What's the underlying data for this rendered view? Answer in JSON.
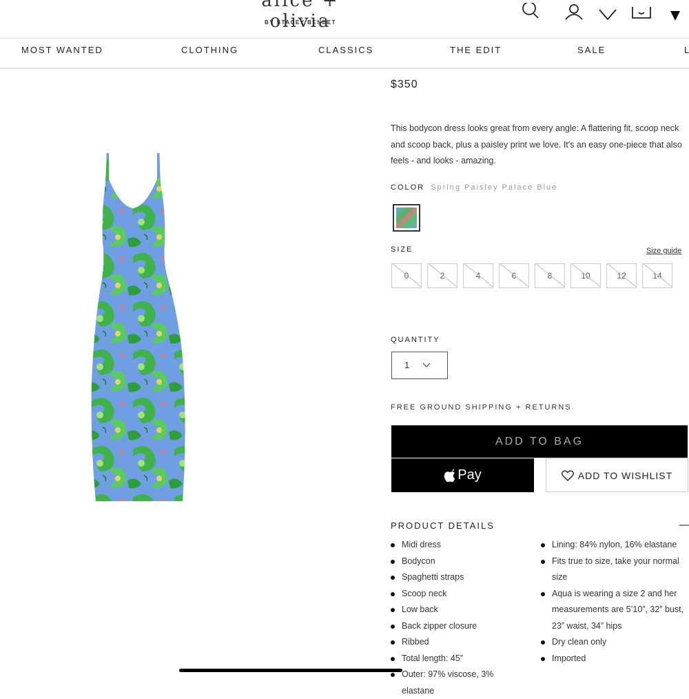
{
  "header": {
    "logo": "alice + olivia",
    "logo_sub": "BY STACEY BENDET",
    "icons": [
      "search-icon",
      "account-icon",
      "wishlist-heart-icon",
      "bag-icon",
      "menu-caret-icon"
    ]
  },
  "nav": {
    "items": [
      "MOST WANTED",
      "CLOTHING",
      "CLASSICS",
      "THE EDIT",
      "SALE",
      "L"
    ]
  },
  "product": {
    "price": "$350",
    "description": "This bodycon dress looks great from every angle: A flattering fit, scoop neck and scoop back, plus a paisley print we love. It's an easy one-piece that also feels - and looks - amazing.",
    "color_label": "COLOR",
    "color_name": "Spring Paisley Palace Blue",
    "size_label": "SIZE",
    "size_guide": "Size guide",
    "sizes": [
      "0",
      "2",
      "4",
      "6",
      "8",
      "10",
      "12",
      "14"
    ],
    "quantity_label": "QUANTITY",
    "quantity_value": "1",
    "shipping": "FREE GROUND SHIPPING + RETURNS",
    "add_to_bag": "ADD TO BAG",
    "apple_pay": "Pay",
    "add_to_wishlist": "ADD TO WISHLIST",
    "details_title": "PRODUCT DETAILS",
    "details_toggle": "—",
    "details_col1": [
      "Midi dress",
      "Bodycon",
      "Spaghetti straps",
      "Scoop neck",
      "Low back",
      "Back zipper closure",
      "Ribbed",
      "Total length: 45”",
      "Outer: 97% viscose, 3% elastane"
    ],
    "details_col2": [
      "Lining: 84% nylon, 16% elastane",
      "Fits true to size, take your normal size",
      "Aqua is wearing a size 2 and her measurements are 5’10”, 32” bust, 23” waist, 34” hips",
      "Dry clean only",
      "Imported"
    ]
  }
}
